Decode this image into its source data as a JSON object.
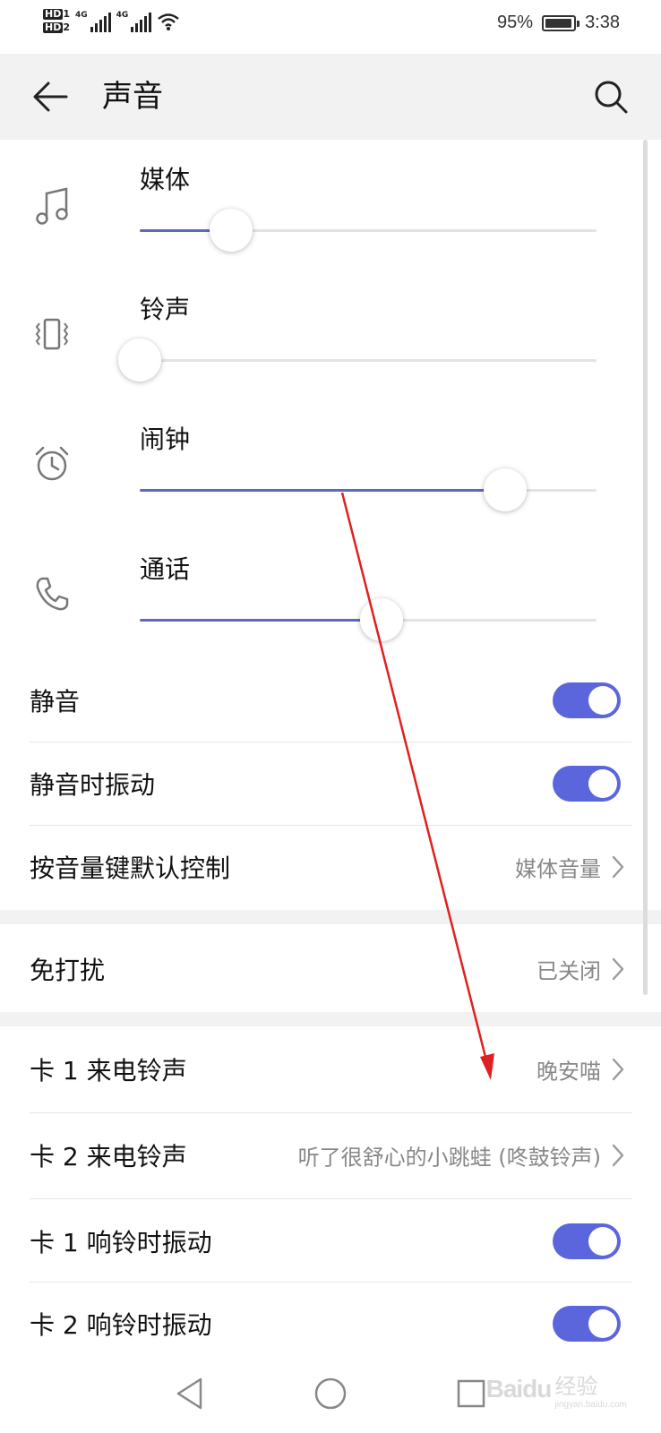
{
  "status_bar": {
    "sim1_label": "HD",
    "sim1_index": "1",
    "sim2_label": "HD",
    "sim2_index": "2",
    "network1": "4G",
    "network2": "4G",
    "battery_percent": "95%",
    "battery_level": 0.95,
    "time": "3:38"
  },
  "toolbar": {
    "back_icon": "arrow-left-icon",
    "title": "声音",
    "search_icon": "search-icon"
  },
  "volumes": [
    {
      "label": "媒体",
      "icon": "music-note-icon",
      "level": 0.2
    },
    {
      "label": "铃声",
      "icon": "vibrate-icon",
      "level": 0.0
    },
    {
      "label": "闹钟",
      "icon": "alarm-clock-icon",
      "level": 0.8
    },
    {
      "label": "通话",
      "icon": "phone-icon",
      "level": 0.53
    }
  ],
  "settings": {
    "mute": {
      "label": "静音",
      "on": true
    },
    "vibrate_when_muted": {
      "label": "静音时振动",
      "on": true
    },
    "volume_key_default": {
      "label": "按音量键默认控制",
      "value": "媒体音量"
    },
    "do_not_disturb": {
      "label": "免打扰",
      "value": "已关闭"
    },
    "sim1_ringtone": {
      "label": "卡 1 来电铃声",
      "value": "晚安喵"
    },
    "sim2_ringtone": {
      "label": "卡 2 来电铃声",
      "value": "听了很舒心的小跳蛙 (咚鼓铃声)"
    },
    "sim1_ring_vibrate": {
      "label": "卡 1 响铃时振动",
      "on": true
    },
    "sim2_ring_vibrate": {
      "label": "卡 2 响铃时振动",
      "on": true
    }
  },
  "nav_bar": {
    "back": "triangle-back-icon",
    "home": "circle-home-icon",
    "recents": "square-recents-icon"
  },
  "watermark": {
    "logo": "Baidu",
    "cn": "经验",
    "url": "jingyan.baidu.com"
  },
  "colors": {
    "accent": "#5c66dc",
    "slider_active": "#5c68c6",
    "track": "#e3e3e3",
    "section_bg": "#f2f2f2",
    "annotation_arrow": "#e02020"
  }
}
